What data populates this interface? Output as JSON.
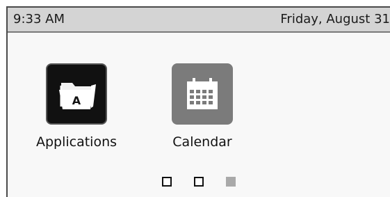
{
  "status_bar": {
    "time": "9:33 AM",
    "date": "Friday, August 31"
  },
  "apps": [
    {
      "label": "Applications",
      "icon": "applications-folder-icon"
    },
    {
      "label": "Calendar",
      "icon": "calendar-icon"
    }
  ],
  "page_indicator": {
    "pages": 3,
    "current_page": 3
  },
  "colors": {
    "status_bar_bg": "#d4d4d4",
    "applications_icon_bg": "#111111",
    "calendar_icon_bg": "#7b7b7b",
    "active_page_dot": "#a9a9a9"
  }
}
